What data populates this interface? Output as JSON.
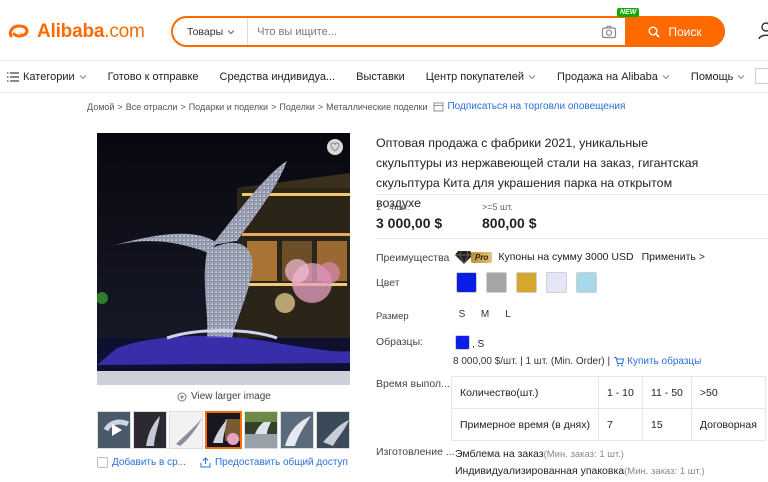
{
  "header": {
    "logo_text": "Alibaba",
    "logo_suffix": ".com",
    "search_category": "Товары",
    "search_placeholder": "Что вы ищите...",
    "new_badge": "NEW",
    "search_button": "Поиск"
  },
  "nav": {
    "items": [
      {
        "label": "Категории",
        "dropdown": true
      },
      {
        "label": "Готово к отправке",
        "dropdown": false
      },
      {
        "label": "Средства индивидуа...",
        "dropdown": false
      },
      {
        "label": "Выставки",
        "dropdown": false
      },
      {
        "label": "Центр покупателей",
        "dropdown": true
      },
      {
        "label": "Продажа на Alibaba",
        "dropdown": true
      },
      {
        "label": "Помощь",
        "dropdown": true
      }
    ]
  },
  "breadcrumb": {
    "items": [
      "Домой",
      "Все отрасли",
      "Подарки и поделки",
      "Поделки",
      "Металлические поделки"
    ],
    "subscribe": "Подписаться на торговли оповещения"
  },
  "gallery": {
    "view_larger": "View larger image",
    "add_compare": "Добавить в ср...",
    "share": "Предоставить общий доступ"
  },
  "product": {
    "title": "Оптовая продажа с фабрики 2021, уникальные скульптуры из нержавеющей стали на заказ, гигантская скульптура Кита для украшения парка на открытом воздухе",
    "prices": [
      {
        "qty": "1 - 4 шт.",
        "price": "3 000,00 $"
      },
      {
        "qty": ">=5 шт.",
        "price": "800,00 $"
      }
    ],
    "benefits_label": "Преимущества",
    "pro_badge": "Pro",
    "coupon_text": "Купоны на сумму 3000 USD",
    "apply_link": "Применить >",
    "color_label": "Цвет",
    "colors": [
      "#0a1ee6",
      "#a5a5a5",
      "#d6a72e",
      "#e4e6f8",
      "#a6d8ea"
    ],
    "size_label": "Размер",
    "sizes": [
      "S",
      "M",
      "L"
    ],
    "samples_label": "Образцы:",
    "sample_color": "#0a1ee6",
    "sample_size": ", S",
    "sample_price": "8 000,00 $/шт. | 1 шт. (Min. Order) |",
    "buy_samples": "Купить образцы",
    "lead_time_label": "Время выпол...",
    "lead_table": {
      "row1": [
        "Количество(шт.)",
        "1 - 10",
        "11 - 50",
        ">50"
      ],
      "row2": [
        "Примерное время (в днях)",
        "7",
        "15",
        "Договорная"
      ]
    },
    "customization_label": "Изготовление ...",
    "customization": [
      {
        "name": "Эмблема на заказ",
        "min": "(Мин. заказ: 1 шт.)"
      },
      {
        "name": "Индивидуализированная упаковка",
        "min": "(Мин. заказ: 1 шт.)"
      }
    ]
  }
}
